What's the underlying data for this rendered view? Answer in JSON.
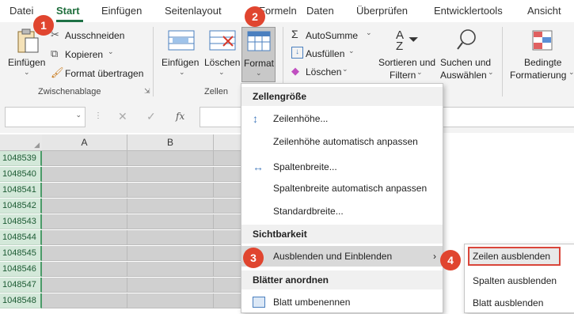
{
  "tabs": [
    {
      "label": "Datei"
    },
    {
      "label": "Start"
    },
    {
      "label": "Einfügen"
    },
    {
      "label": "Seitenlayout"
    },
    {
      "label": "Formeln"
    },
    {
      "label": "Daten"
    },
    {
      "label": "Überprüfen"
    },
    {
      "label": "Entwicklertools"
    },
    {
      "label": "Ansicht"
    }
  ],
  "clipboard": {
    "paste": "Einfügen",
    "cut": "Ausschneiden",
    "copy": "Kopieren",
    "format_painter": "Format übertragen",
    "group": "Zwischenablage"
  },
  "cells": {
    "insert": "Einfügen",
    "delete": "Löschen",
    "format": "Format",
    "group": "Zellen"
  },
  "editing": {
    "autosum": "AutoSumme",
    "fill": "Ausfüllen",
    "clear": "Löschen",
    "sort": "Sortieren und",
    "sort2": "Filtern",
    "find": "Suchen und",
    "find2": "Auswählen",
    "cond": "Bedingte",
    "cond2": "Formatierung"
  },
  "formula_bar": {
    "fx": "fx"
  },
  "columns": [
    "A",
    "B"
  ],
  "rows": [
    "1048539",
    "1048540",
    "1048541",
    "1048542",
    "1048543",
    "1048544",
    "1048545",
    "1048546",
    "1048547",
    "1048548"
  ],
  "menu": {
    "sec_cellsize": "Zellengröße",
    "row_height": "Zeilenhöhe...",
    "autofit_row": "Zeilenhöhe automatisch anpassen",
    "col_width": "Spaltenbreite...",
    "autofit_col": "Spaltenbreite automatisch anpassen",
    "default_width": "Standardbreite...",
    "sec_visibility": "Sichtbarkeit",
    "hide_unhide": "Ausblenden und Einblenden",
    "sec_sheets": "Blätter anordnen",
    "rename": "Blatt umbenennen"
  },
  "submenu": {
    "hide_rows": "Zeilen ausblenden",
    "hide_cols": "Spalten ausblenden",
    "hide_sheet": "Blatt ausblenden"
  },
  "badges": {
    "b1": "1",
    "b2": "2",
    "b3": "3",
    "b4": "4"
  },
  "colors": {
    "accent": "#1e7145",
    "badge": "#e0452f",
    "highlight_border": "#d9453a"
  }
}
